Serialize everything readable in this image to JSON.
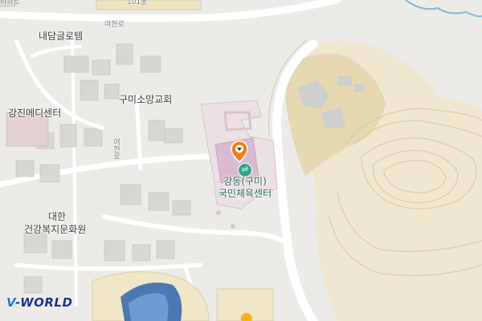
{
  "map": {
    "labels": {
      "top_left_partial": "하파트",
      "top_building": "101동",
      "road_top": "여현로",
      "naedam": "내담글로템",
      "gumi_church": "구미소망교회",
      "gangjin": "강진메디센터",
      "road_side": "여현로",
      "daehan_line1": "대한",
      "daehan_line2": "건강복지문화원"
    },
    "target_poi": {
      "line1": "강동(구미)",
      "line2": "국민체육센터",
      "badge_icon": "sports-center-icon",
      "marker_icon": "location-pin-icon"
    },
    "logo": {
      "v": "V",
      "rest": "-WORLD"
    },
    "colors": {
      "background": "#ecebe7",
      "road": "#ffffff",
      "building": "#d8d6d1",
      "sports_area": "#dcbcd0",
      "hill": "#eee6cf",
      "marker": "#ef7d1a",
      "poi_text": "#2c6a5a"
    }
  }
}
